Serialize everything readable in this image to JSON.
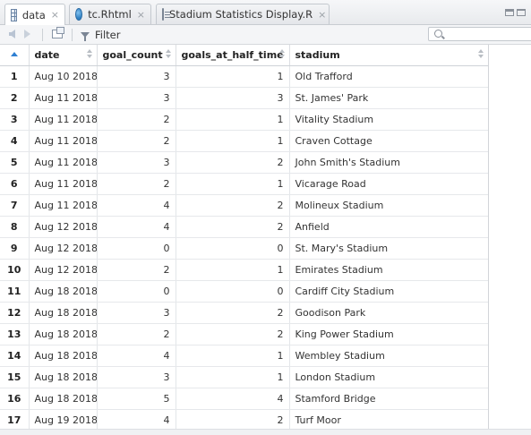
{
  "tabs": [
    {
      "label": "data",
      "icon": "grid-icon",
      "active": true
    },
    {
      "label": "tc.Rhtml",
      "icon": "globe-icon",
      "active": false
    },
    {
      "label": "Stadium Statistics Display.R",
      "icon": "script-icon",
      "active": false
    }
  ],
  "tab_close_glyph": "×",
  "toolbar": {
    "filter_label": "Filter",
    "search_placeholder": ""
  },
  "table": {
    "columns": [
      "date",
      "goal_count",
      "goals_at_half_time",
      "stadium"
    ],
    "rows": [
      {
        "n": "1",
        "date": "Aug 10 2018",
        "goal_count": "3",
        "goals_at_half_time": "1",
        "stadium": "Old Trafford"
      },
      {
        "n": "2",
        "date": "Aug 11 2018",
        "goal_count": "3",
        "goals_at_half_time": "3",
        "stadium": "St. James' Park"
      },
      {
        "n": "3",
        "date": "Aug 11 2018",
        "goal_count": "2",
        "goals_at_half_time": "1",
        "stadium": "Vitality Stadium"
      },
      {
        "n": "4",
        "date": "Aug 11 2018",
        "goal_count": "2",
        "goals_at_half_time": "1",
        "stadium": "Craven Cottage"
      },
      {
        "n": "5",
        "date": "Aug 11 2018",
        "goal_count": "3",
        "goals_at_half_time": "2",
        "stadium": "John Smith's Stadium"
      },
      {
        "n": "6",
        "date": "Aug 11 2018",
        "goal_count": "2",
        "goals_at_half_time": "1",
        "stadium": "Vicarage Road"
      },
      {
        "n": "7",
        "date": "Aug 11 2018",
        "goal_count": "4",
        "goals_at_half_time": "2",
        "stadium": "Molineux Stadium"
      },
      {
        "n": "8",
        "date": "Aug 12 2018",
        "goal_count": "4",
        "goals_at_half_time": "2",
        "stadium": "Anfield"
      },
      {
        "n": "9",
        "date": "Aug 12 2018",
        "goal_count": "0",
        "goals_at_half_time": "0",
        "stadium": "St. Mary's Stadium"
      },
      {
        "n": "10",
        "date": "Aug 12 2018",
        "goal_count": "2",
        "goals_at_half_time": "1",
        "stadium": "Emirates Stadium"
      },
      {
        "n": "11",
        "date": "Aug 18 2018",
        "goal_count": "0",
        "goals_at_half_time": "0",
        "stadium": "Cardiff City Stadium"
      },
      {
        "n": "12",
        "date": "Aug 18 2018",
        "goal_count": "3",
        "goals_at_half_time": "2",
        "stadium": "Goodison Park"
      },
      {
        "n": "13",
        "date": "Aug 18 2018",
        "goal_count": "2",
        "goals_at_half_time": "2",
        "stadium": "King Power Stadium"
      },
      {
        "n": "14",
        "date": "Aug 18 2018",
        "goal_count": "4",
        "goals_at_half_time": "1",
        "stadium": "Wembley Stadium"
      },
      {
        "n": "15",
        "date": "Aug 18 2018",
        "goal_count": "3",
        "goals_at_half_time": "1",
        "stadium": "London Stadium"
      },
      {
        "n": "16",
        "date": "Aug 18 2018",
        "goal_count": "5",
        "goals_at_half_time": "4",
        "stadium": "Stamford Bridge"
      },
      {
        "n": "17",
        "date": "Aug 19 2018",
        "goal_count": "4",
        "goals_at_half_time": "2",
        "stadium": "Turf Moor"
      }
    ]
  }
}
